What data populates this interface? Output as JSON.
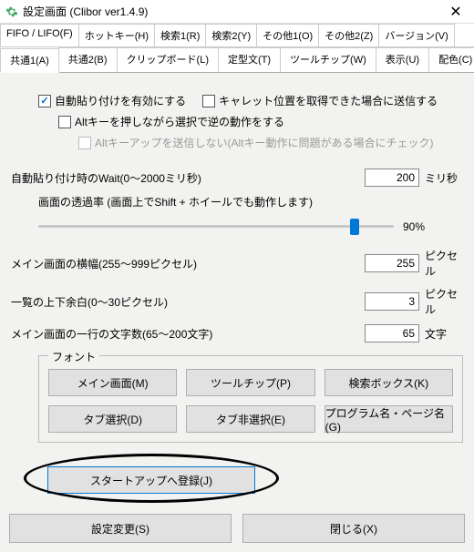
{
  "window": {
    "title": "設定画面 (Clibor ver1.4.9)"
  },
  "tabs_row1": [
    {
      "label": "FIFO / LIFO(F)"
    },
    {
      "label": "ホットキー(H)"
    },
    {
      "label": "検索1(R)"
    },
    {
      "label": "検索2(Y)"
    },
    {
      "label": "その他1(O)"
    },
    {
      "label": "その他2(Z)"
    },
    {
      "label": "バージョン(V)"
    }
  ],
  "tabs_row2": [
    {
      "label": "共通1(A)"
    },
    {
      "label": "共通2(B)"
    },
    {
      "label": "クリップボード(L)"
    },
    {
      "label": "定型文(T)"
    },
    {
      "label": "ツールチップ(W)"
    },
    {
      "label": "表示(U)"
    },
    {
      "label": "配色(C)"
    }
  ],
  "checks": {
    "auto_paste": "自動貼り付けを有効にする",
    "caret": "キャレット位置を取得できた場合に送信する",
    "alt_reverse": "Altキーを押しながら選択で逆の動作をする",
    "alt_keyup": "Altキーアップを送信しない(Altキー動作に問題がある場合にチェック)"
  },
  "fields": {
    "wait": {
      "label": "自動貼り付け時のWait(0～2000ミリ秒)",
      "value": "200",
      "unit": "ミリ秒"
    },
    "opacity": {
      "label": "画面の透過率 (画面上でShift + ホイールでも動作します)",
      "value": "90%",
      "percent": 90
    },
    "width": {
      "label": "メイン画面の横幅(255～999ピクセル)",
      "value": "255",
      "unit": "ピクセル"
    },
    "margin": {
      "label": "一覧の上下余白(0～30ピクセル)",
      "value": "3",
      "unit": "ピクセル"
    },
    "chars": {
      "label": "メイン画面の一行の文字数(65～200文字)",
      "value": "65",
      "unit": "文字"
    }
  },
  "font_group": {
    "legend": "フォント",
    "buttons": [
      "メイン画面(M)",
      "ツールチップ(P)",
      "検索ボックス(K)",
      "タブ選択(D)",
      "タブ非選択(E)",
      "プログラム名・ページ名(G)"
    ]
  },
  "startup": {
    "label": "スタートアップへ登録(J)"
  },
  "bottom": {
    "apply": "設定変更(S)",
    "close": "閉じる(X)"
  }
}
